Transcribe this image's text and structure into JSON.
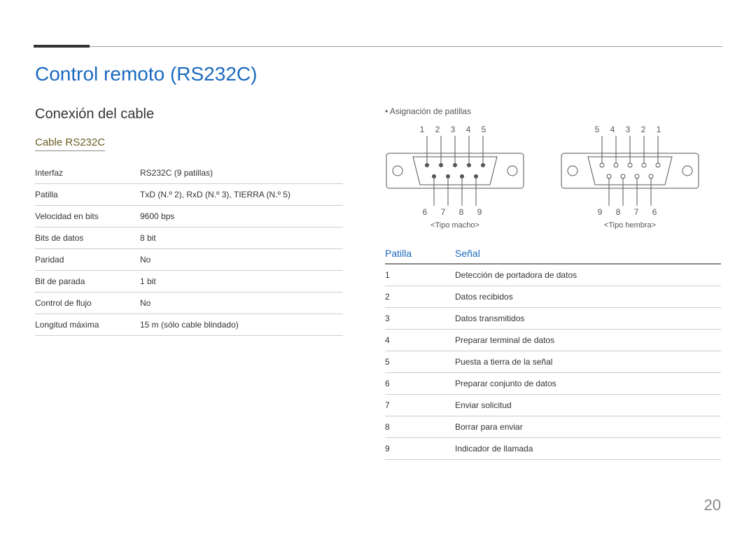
{
  "title": "Control remoto (RS232C)",
  "section": "Conexión del cable",
  "subsection": "Cable RS232C",
  "specs": [
    {
      "label": "Interfaz",
      "value": "RS232C (9 patillas)"
    },
    {
      "label": "Patilla",
      "value": "TxD (N.º 2), RxD (N.º 3), TIERRA (N.º 5)"
    },
    {
      "label": "Velocidad en bits",
      "value": "9600 bps"
    },
    {
      "label": "Bits de datos",
      "value": "8 bit"
    },
    {
      "label": "Paridad",
      "value": "No"
    },
    {
      "label": "Bit de parada",
      "value": "1 bit"
    },
    {
      "label": "Control de flujo",
      "value": "No"
    },
    {
      "label": "Longitud máxima",
      "value": "15 m (sólo cable blindado)"
    }
  ],
  "pin_assignment_label": "Asignación de patillas",
  "connectors": {
    "male": {
      "top": "1  2  3  4  5",
      "bottom": "6  7  8  9",
      "label": "<Tipo macho>"
    },
    "female": {
      "top": "5  4  3  2  1",
      "bottom": "9  8  7  6",
      "label": "<Tipo hembra>"
    }
  },
  "signal_table": {
    "headers": {
      "pin": "Patilla",
      "signal": "Señal"
    },
    "rows": [
      {
        "pin": "1",
        "signal": "Detección de portadora de datos"
      },
      {
        "pin": "2",
        "signal": "Datos recibidos"
      },
      {
        "pin": "3",
        "signal": "Datos transmitidos"
      },
      {
        "pin": "4",
        "signal": "Preparar terminal de datos"
      },
      {
        "pin": "5",
        "signal": "Puesta a tierra de la señal"
      },
      {
        "pin": "6",
        "signal": "Preparar conjunto de datos"
      },
      {
        "pin": "7",
        "signal": "Enviar solicitud"
      },
      {
        "pin": "8",
        "signal": "Borrar para enviar"
      },
      {
        "pin": "9",
        "signal": "Indicador de llamada"
      }
    ]
  },
  "page_number": "20"
}
